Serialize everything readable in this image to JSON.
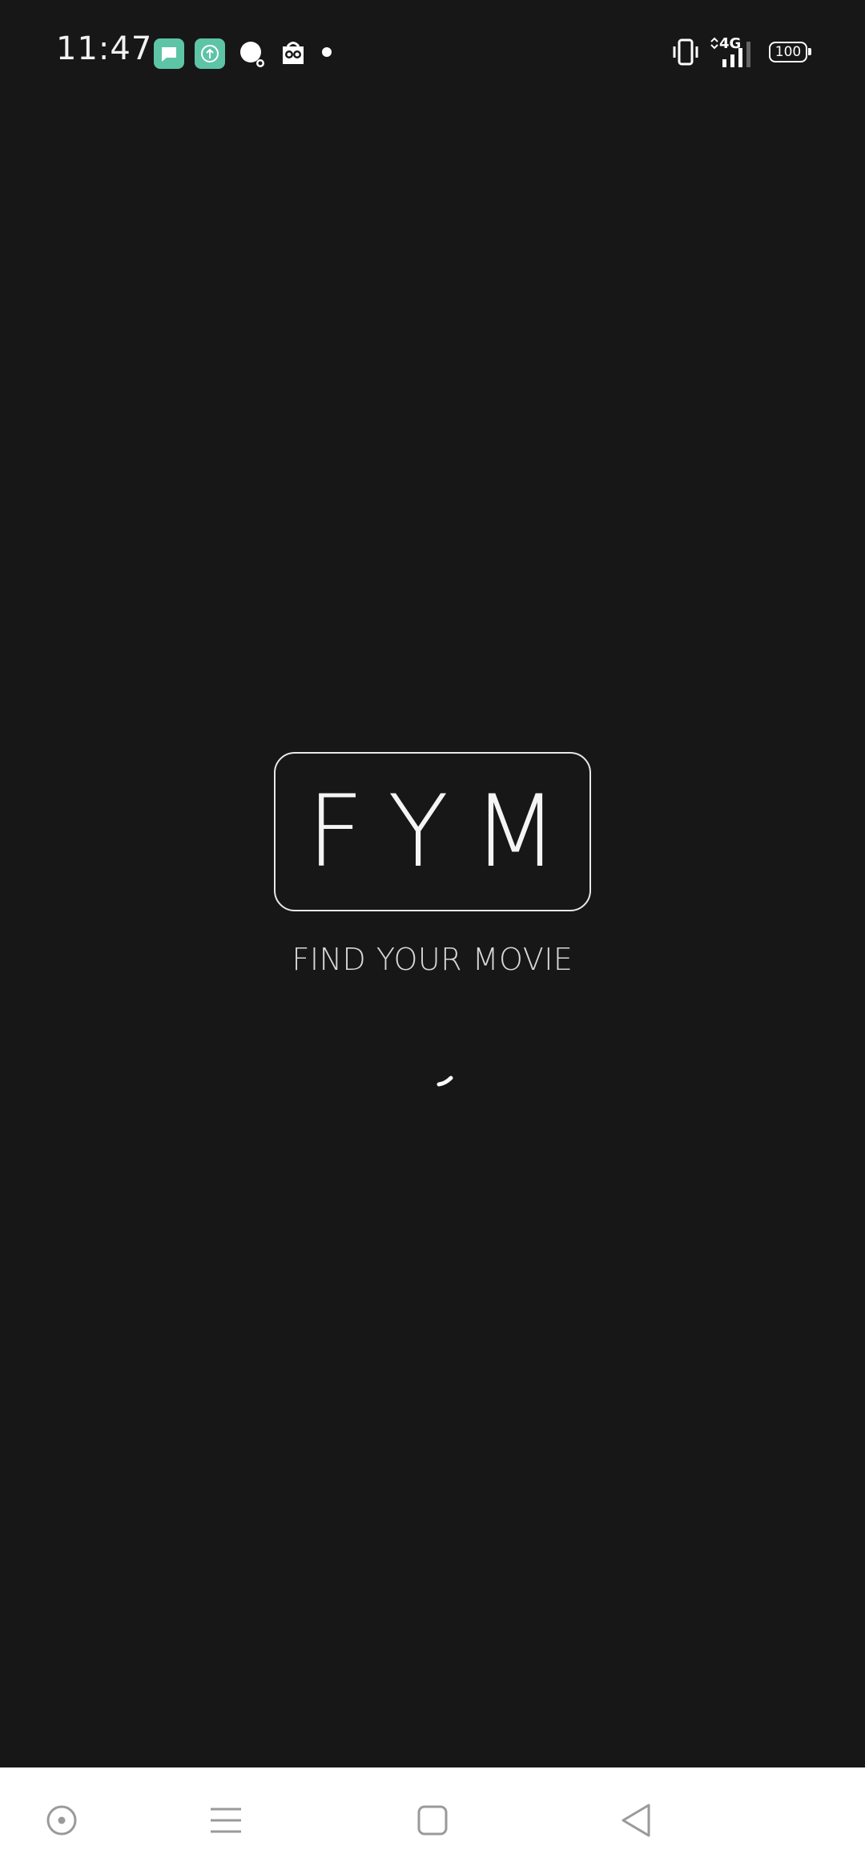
{
  "status_bar": {
    "time": "11:47",
    "battery_level": "100",
    "network_type": "4G",
    "notification_icons": [
      "message-app-icon",
      "upload-app-icon",
      "search-app-icon",
      "owl-app-icon",
      "more-notifications-dot"
    ],
    "system_icons": [
      "vibrate-icon",
      "signal-icon",
      "battery-icon"
    ]
  },
  "splash": {
    "logo_text": "FYM",
    "tagline": "FIND YOUR MOVIE",
    "loading": true
  },
  "nav_bar": {
    "buttons": [
      "assistant-button",
      "menu-button",
      "home-button",
      "back-button"
    ]
  },
  "colors": {
    "background": "#171717",
    "text": "#f4f4f4",
    "notification_accent": "#5ec4a6",
    "nav_background": "#ffffff",
    "nav_icon": "#9a9a9a"
  }
}
